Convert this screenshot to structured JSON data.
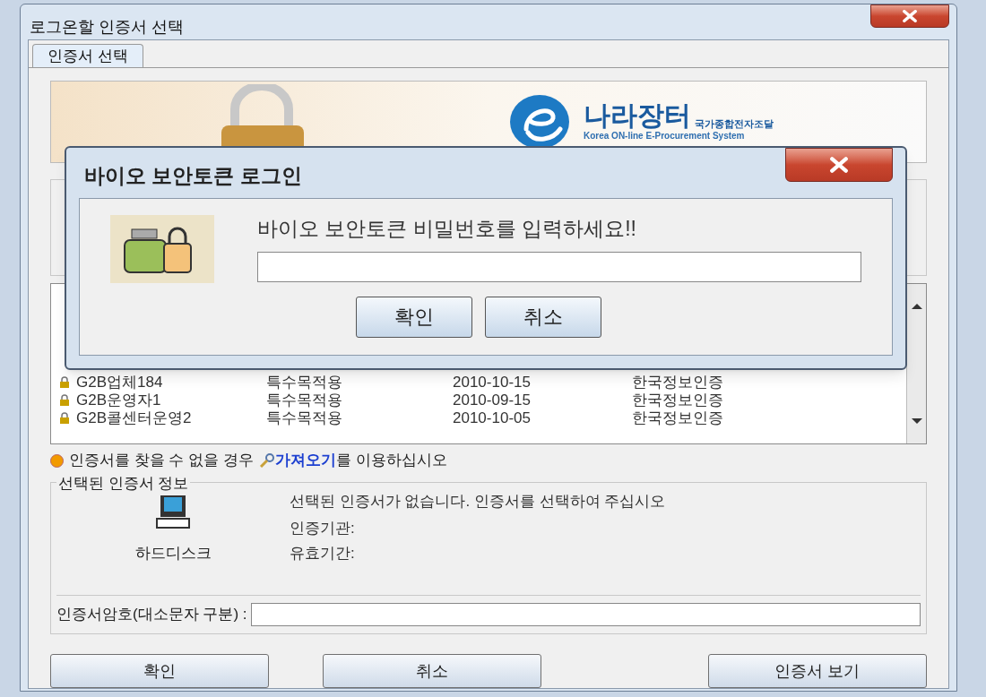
{
  "window": {
    "title": "로그온할 인증서 선택"
  },
  "tabs": [
    {
      "label": "인증서 선택",
      "selected": true
    }
  ],
  "banner": {
    "brand": "나라장터",
    "brand_subtitle": "국가종합전자조달",
    "brand_english": "Korea ON-line E-Procurement System"
  },
  "certificate_list": {
    "rows": [
      {
        "cells": [
          "G2B업체184",
          "특수목적용",
          "2010-10-15",
          "한국정보인증"
        ]
      },
      {
        "cells": [
          "G2B운영자1",
          "특수목적용",
          "2010-09-15",
          "한국정보인증"
        ]
      },
      {
        "cells": [
          "G2B콜센터운영2",
          "특수목적용",
          "2010-10-05",
          "한국정보인증"
        ]
      }
    ]
  },
  "notice": {
    "text": "인증서를 찾을 수 없을 경우",
    "link": "가져오기",
    "suffix": "를 이용하십시오"
  },
  "selected_info": {
    "legend": "선택된 인증서 정보",
    "drive_label": "하드디스크",
    "message": "선택된 인증서가 없습니다. 인증서를 선택하여 주십시오",
    "issuer_label": "인증기관:",
    "validity_label": "유효기간:"
  },
  "password": {
    "label": "인증서암호(대소문자 구분) :"
  },
  "buttons": [
    "확인",
    "취소",
    "인증서 보기"
  ],
  "modal": {
    "title": "바이오 보안토큰 로그인",
    "prompt": "바이오 보안토큰 비밀번호를 입력하세요!!",
    "buttons": [
      "확인",
      "취소"
    ]
  }
}
